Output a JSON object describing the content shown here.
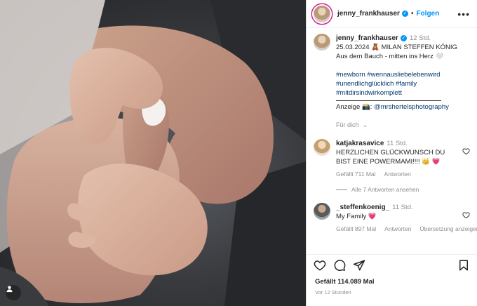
{
  "post": {
    "username": "jenny_frankhauser",
    "follow_label": "Folgen",
    "more_label": "•••"
  },
  "caption": {
    "username": "jenny_frankhauser",
    "time": "12 Std.",
    "line1": "25.03.2024 🧸 MILAN STEFFEN KÖNIG",
    "line2": "Aus dem Bauch - mitten ins Herz 🤍",
    "hashtags_line1": "#newborn #wennausliebelebenwird",
    "hashtags_line2": "#unendlichglücklich #family",
    "hashtags_line3": "#mitdirsindwirkomplett",
    "ad_prefix": "Anzeige 📸: ",
    "ad_mention": "@mrshertelsphotography",
    "translate": "Für dich"
  },
  "comments": [
    {
      "username": "katjakrasavice",
      "time": "11 Std.",
      "text_line1": "HERZLICHEN GLÜCKWUNSCH DU",
      "text_line2": "BIST EINE POWERMAMI!!!! 👑 💗",
      "likes": "Gefällt 711 Mal",
      "reply": "Antworten",
      "view_replies": "Alle 7 Antworten ansehen"
    },
    {
      "username": "_steffenkoenig_",
      "time": "11 Std.",
      "text": "My Family 💗",
      "likes": "Gefällt 897 Mal",
      "reply": "Antworten",
      "translation": "Übersetzung anzeigen"
    }
  ],
  "footer": {
    "likes": "Gefällt 114.089 Mal",
    "ago": "Vor 12 Stunden"
  },
  "colors": {
    "accent": "#0095f6",
    "link": "#00376b",
    "muted": "#8e8e8e",
    "heart": "#ed4956"
  }
}
